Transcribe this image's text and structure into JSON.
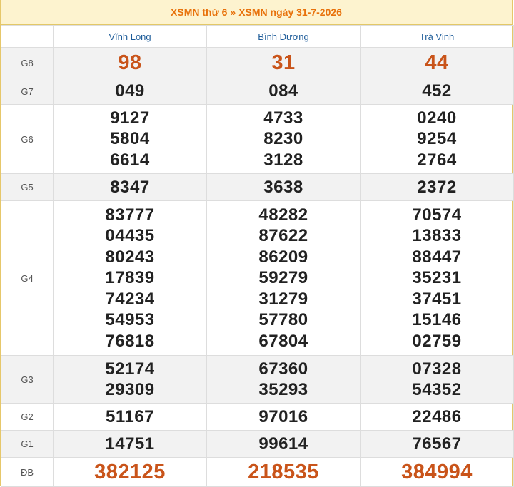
{
  "header": {
    "link1": "XSMN thứ 6",
    "separator": "»",
    "link2": "XSMN ngày 31-7-2026"
  },
  "provinces": [
    "Vĩnh Long",
    "Bình Dương",
    "Trà Vinh"
  ],
  "prizes": {
    "G8": {
      "label": "G8",
      "values": [
        [
          "98"
        ],
        [
          "31"
        ],
        [
          "44"
        ]
      ]
    },
    "G7": {
      "label": "G7",
      "values": [
        [
          "049"
        ],
        [
          "084"
        ],
        [
          "452"
        ]
      ]
    },
    "G6": {
      "label": "G6",
      "values": [
        [
          "9127",
          "5804",
          "6614"
        ],
        [
          "4733",
          "8230",
          "3128"
        ],
        [
          "0240",
          "9254",
          "2764"
        ]
      ]
    },
    "G5": {
      "label": "G5",
      "values": [
        [
          "8347"
        ],
        [
          "3638"
        ],
        [
          "2372"
        ]
      ]
    },
    "G4": {
      "label": "G4",
      "values": [
        [
          "83777",
          "04435",
          "80243",
          "17839",
          "74234",
          "54953",
          "76818"
        ],
        [
          "48282",
          "87622",
          "86209",
          "59279",
          "31279",
          "57780",
          "67804"
        ],
        [
          "70574",
          "13833",
          "88447",
          "35231",
          "37451",
          "15146",
          "02759"
        ]
      ]
    },
    "G3": {
      "label": "G3",
      "values": [
        [
          "52174",
          "29309"
        ],
        [
          "67360",
          "35293"
        ],
        [
          "07328",
          "54352"
        ]
      ]
    },
    "G2": {
      "label": "G2",
      "values": [
        [
          "51167"
        ],
        [
          "97016"
        ],
        [
          "22486"
        ]
      ]
    },
    "G1": {
      "label": "G1",
      "values": [
        [
          "14751"
        ],
        [
          "99614"
        ],
        [
          "76567"
        ]
      ]
    },
    "DB": {
      "label": "ĐB",
      "values": [
        [
          "382125"
        ],
        [
          "218535"
        ],
        [
          "384994"
        ]
      ]
    }
  },
  "colors": {
    "highlight": "#c9541a",
    "province": "#1e5c99",
    "header_bg": "#fdf3cf"
  }
}
